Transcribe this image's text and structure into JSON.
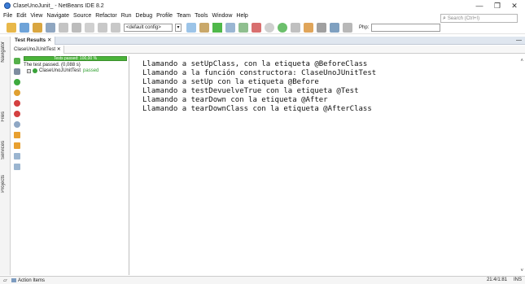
{
  "window": {
    "title": "ClaseUnoJunit_ - NetBeans IDE 8.2",
    "minimize_glyph": "—",
    "maximize_glyph": "❐",
    "close_glyph": "✕"
  },
  "menu": [
    "File",
    "Edit",
    "View",
    "Navigate",
    "Source",
    "Refactor",
    "Run",
    "Debug",
    "Profile",
    "Team",
    "Tools",
    "Window",
    "Help"
  ],
  "search": {
    "placeholder": "Search (Ctrl+I)"
  },
  "toolbar": {
    "config_value": "<default config>",
    "php_label": "Php:"
  },
  "sidebar_tabs": [
    "Navigator",
    "Files",
    "Services",
    "Projects"
  ],
  "results": {
    "tab_label": "Test Results",
    "subtab_label": "ClaseUnoJUnitTest",
    "progress_text": "Tests passed: 100,00 %",
    "progress_fraction": 1.0,
    "summary": "The test passed. (0,088 s)",
    "tree_node": "ClaseUnoJUnitTest",
    "tree_status": "passed"
  },
  "output_lines": [
    "Llamando a setUpClass, con la etiqueta @BeforeClass",
    "Llamando a la función constructora: ClaseUnoJUnitTest",
    "Llamando a setUp con la etiqueta @Before",
    "Llamando a testDevuelveTrue con la etiqueta @Test",
    "Llamando a tearDown con la etiqueta @After",
    "Llamando a tearDownClass con la etiqueta @AfterClass"
  ],
  "status": {
    "action_items": "Action Items",
    "position": "21:4/1:81",
    "mode": "INS"
  },
  "colors": {
    "progress": "#4bb43a",
    "passed": "#2e9f2e",
    "accent": "#3a7bd5"
  }
}
